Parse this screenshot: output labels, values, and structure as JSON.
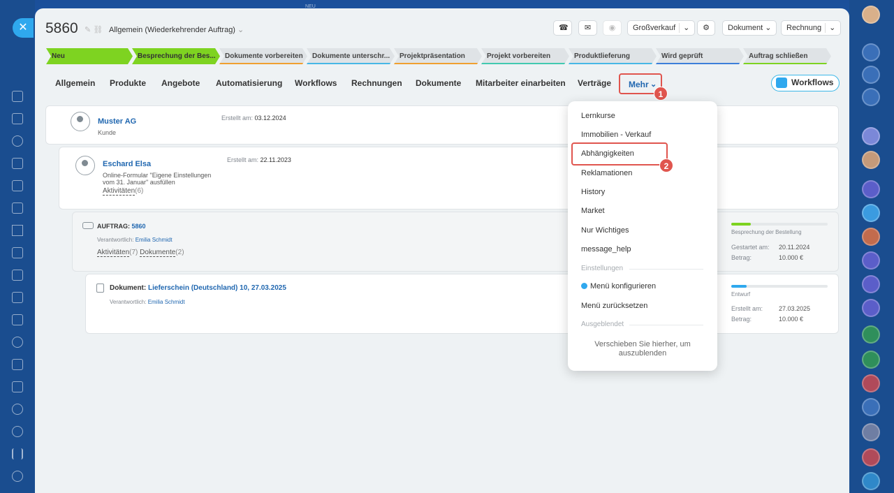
{
  "header": {
    "top_label": "NEU",
    "deal_id": "5860",
    "category": "Allgemein (Wiederkehrender Auftrag)",
    "buttons": {
      "pricing": "Großverkauf",
      "document": "Dokument",
      "invoice": "Rechnung"
    }
  },
  "stages": [
    {
      "label": "Neu",
      "color": "#7ed321"
    },
    {
      "label": "Besprechung der Bes...",
      "color": "#7ed321"
    },
    {
      "label": "Dokumente vorbereiten",
      "color": "#f0a030"
    },
    {
      "label": "Dokumente unterschr...",
      "color": "#47b7e6"
    },
    {
      "label": "Projektpräsentation",
      "color": "#f0a030"
    },
    {
      "label": "Projekt vorbereiten",
      "color": "#42c9b0"
    },
    {
      "label": "Produktlieferung",
      "color": "#47b7e6"
    },
    {
      "label": "Wird geprüft",
      "color": "#3d7fd9"
    },
    {
      "label": "Auftrag schließen",
      "color": "#7ed321"
    }
  ],
  "tabs": [
    "Allgemein",
    "Produkte",
    "Angebote",
    "Automatisierung",
    "Workflows",
    "Rechnungen",
    "Dokumente",
    "Mitarbeiter einarbeiten",
    "Verträge"
  ],
  "more_tab": "Mehr",
  "workflows_button": "Workflows",
  "markers": [
    "1",
    "2"
  ],
  "company": {
    "name": "Muster AG",
    "type": "Kunde",
    "created_label": "Erstellt am:",
    "created": "03.12.2024"
  },
  "contact": {
    "name": "Eschard Elsa",
    "form_line1": "Online-Formular \"Eigene Einstellungen",
    "form_line2": "vom 31. Januar\" ausfüllen",
    "activities": "Aktivitäten",
    "activities_count": "(6)",
    "created_label": "Erstellt am:",
    "created": "22.11.2023"
  },
  "order": {
    "label": "AUFTRAG:",
    "number": "5860",
    "responsible_label": "Verantwortlich:",
    "responsible": "Emilia Schmidt",
    "activities": "Aktivitäten",
    "activities_count": "(7)",
    "documents": "Dokumente",
    "documents_count": "(2)",
    "stage": "Besprechung der Bestellung",
    "progress": 0.2,
    "started_label": "Gestartet am:",
    "started": "20.11.2024",
    "amount_label": "Betrag:",
    "amount": "10.000 €"
  },
  "document": {
    "label": "Dokument:",
    "title": "Lieferschein (Deutschland) 10, 27.03.2025",
    "responsible_label": "Verantwortlich:",
    "responsible": "Emilia Schmidt",
    "status": "Entwurf",
    "progress": 0.16,
    "created_label": "Erstellt am:",
    "created": "27.03.2025",
    "amount_label": "Betrag:",
    "amount": "10.000 €"
  },
  "dropdown": {
    "items": [
      "Lernkurse",
      "Immobilien - Verkauf",
      "Abhängigkeiten",
      "Reklamationen",
      "History",
      "Market",
      "Nur Wichtiges",
      "message_help"
    ],
    "settings_header": "Einstellungen",
    "configure": "Menü konfigurieren",
    "reset": "Menü zurücksetzen",
    "hidden_header": "Ausgeblendet",
    "hidden_note": "Verschieben Sie hierher, um auszublenden"
  }
}
